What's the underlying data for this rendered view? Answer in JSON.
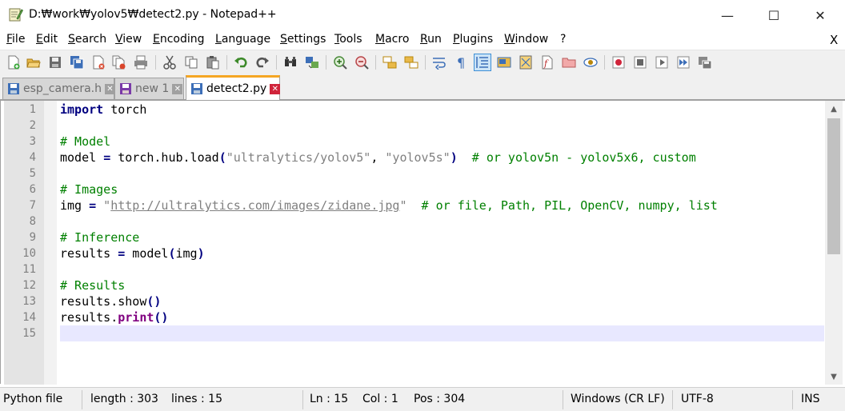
{
  "window": {
    "title": "D:₩work₩yolov5₩detect2.py - Notepad++",
    "min_glyph": "—",
    "max_glyph": "☐",
    "close_glyph": "✕"
  },
  "menu": {
    "items": [
      "File",
      "Edit",
      "Search",
      "View",
      "Encoding",
      "Language",
      "Settings",
      "Tools",
      "Macro",
      "Run",
      "Plugins",
      "Window",
      "?"
    ],
    "close_doc": "X"
  },
  "toolbar": {
    "icons": [
      "new-file-icon",
      "open-file-icon",
      "save-icon",
      "save-all-icon",
      "close-icon",
      "close-all-icon",
      "print-icon",
      "cut-icon",
      "copy-icon",
      "paste-icon",
      "undo-icon",
      "redo-icon",
      "find-icon",
      "replace-icon",
      "zoom-in-icon",
      "zoom-out-icon",
      "sync-vertical-icon",
      "sync-horizontal-icon",
      "word-wrap-icon",
      "show-all-chars-icon",
      "indent-guide-icon",
      "language-icon",
      "document-map-icon",
      "function-list-icon",
      "folder-workspace-icon",
      "monitoring-icon",
      "record-macro-icon",
      "stop-macro-icon",
      "play-macro-icon",
      "run-macro-multiple-icon",
      "save-macro-icon"
    ]
  },
  "tabs": [
    {
      "label": "esp_camera.h",
      "close": "✕",
      "active": false
    },
    {
      "label": "new 1",
      "close": "✕",
      "active": false
    },
    {
      "label": "detect2.py",
      "close": "✕",
      "active": true
    }
  ],
  "editor": {
    "line_numbers": [
      "1",
      "2",
      "3",
      "4",
      "5",
      "6",
      "7",
      "8",
      "9",
      "10",
      "11",
      "12",
      "13",
      "14",
      "15"
    ],
    "current_line": 15,
    "lines": [
      [
        {
          "t": "import",
          "c": "kw"
        },
        {
          "t": " torch",
          "c": ""
        }
      ],
      [],
      [
        {
          "t": "# Model",
          "c": "cm"
        }
      ],
      [
        {
          "t": "model ",
          "c": ""
        },
        {
          "t": "=",
          "c": "op"
        },
        {
          "t": " torch.hub.load",
          "c": ""
        },
        {
          "t": "(",
          "c": "op"
        },
        {
          "t": "\"ultralytics/yolov5\"",
          "c": "str"
        },
        {
          "t": ", ",
          "c": ""
        },
        {
          "t": "\"yolov5s\"",
          "c": "str"
        },
        {
          "t": ")",
          "c": "op"
        },
        {
          "t": "  # or yolov5n - yolov5x6, custom",
          "c": "cm"
        }
      ],
      [],
      [
        {
          "t": "# Images",
          "c": "cm"
        }
      ],
      [
        {
          "t": "img ",
          "c": ""
        },
        {
          "t": "=",
          "c": "op"
        },
        {
          "t": " \"",
          "c": "str"
        },
        {
          "t": "http://ultralytics.com/images/zidane.jpg",
          "c": "url"
        },
        {
          "t": "\"",
          "c": "str"
        },
        {
          "t": "  # or file, Path, PIL, OpenCV, numpy, list",
          "c": "cm"
        }
      ],
      [],
      [
        {
          "t": "# Inference",
          "c": "cm"
        }
      ],
      [
        {
          "t": "results ",
          "c": ""
        },
        {
          "t": "=",
          "c": "op"
        },
        {
          "t": " model",
          "c": ""
        },
        {
          "t": "(",
          "c": "op"
        },
        {
          "t": "img",
          "c": ""
        },
        {
          "t": ")",
          "c": "op"
        }
      ],
      [],
      [
        {
          "t": "# Results",
          "c": "cm"
        }
      ],
      [
        {
          "t": "results.show",
          "c": ""
        },
        {
          "t": "()",
          "c": "op"
        }
      ],
      [
        {
          "t": "results.",
          "c": ""
        },
        {
          "t": "print",
          "c": "kw2"
        },
        {
          "t": "()",
          "c": "op"
        }
      ],
      []
    ]
  },
  "scrollbar": {
    "up": "▲",
    "down": "▼"
  },
  "status": {
    "file_type": "Python file",
    "length": "length : 303",
    "lines": "lines : 15",
    "ln": "Ln : 15",
    "col": "Col : 1",
    "pos": "Pos : 304",
    "eol": "Windows (CR LF)",
    "encoding": "UTF-8",
    "mode": "INS"
  }
}
